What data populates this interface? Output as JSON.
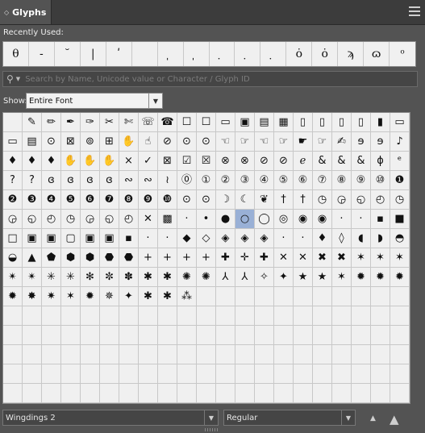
{
  "panel": {
    "tab_label": "Glyphs"
  },
  "recent": {
    "label": "Recently Used:",
    "glyphs": [
      "θ",
      "-",
      "˘",
      "|",
      "ʹ",
      "",
      "̩ ",
      "̩ ",
      "̣ ",
      "̣ ",
      "̣ ",
      "ȯ",
      "ȯ",
      "ϡ",
      "ɷ",
      "ᵒ"
    ]
  },
  "search": {
    "placeholder": "Search by Name, Unicode value or Character / Glyph ID",
    "value": ""
  },
  "show": {
    "label": "Show:",
    "value": "Entire Font"
  },
  "glyph_grid": {
    "selected_index": 117,
    "cells": [
      "",
      "✎",
      "✏",
      "✒",
      "✑",
      "✂",
      "✄",
      "☏",
      "☎",
      "☐",
      "☐",
      "▭",
      "▣",
      "▤",
      "▦",
      "▯",
      "▯",
      "▯",
      "▯",
      "▮",
      "▭",
      "▭",
      "▤",
      "⊙",
      "⊠",
      "⊚",
      "⊞",
      "✋",
      "☝",
      "⊘",
      "⊙",
      "⊙",
      "☜",
      "☞",
      "☜",
      "☞",
      "☛",
      "☞",
      "✍",
      "ɘ",
      "ɘ",
      "♪",
      "♦",
      "♦",
      "♦",
      "✋",
      "✋",
      "✋",
      "×",
      "✓",
      "⊠",
      "☑",
      "☒",
      "⊗",
      "⊗",
      "⊘",
      "⊘",
      "ℯ",
      "&",
      "&",
      "&",
      "ɸ",
      "ᵉ",
      "?",
      "?",
      "ɞ",
      "ɞ",
      "ɞ",
      "ɞ",
      "∾",
      "∾",
      "≀",
      "⓪",
      "①",
      "②",
      "③",
      "④",
      "⑤",
      "⑥",
      "⑦",
      "⑧",
      "⑨",
      "⑩",
      "❶",
      "❷",
      "❸",
      "❹",
      "❺",
      "❻",
      "❼",
      "❽",
      "❾",
      "❿",
      "⊙",
      "⊙",
      "☽",
      "☾",
      "❦",
      "†",
      "†",
      "◷",
      "◶",
      "◵",
      "◴",
      "◷",
      "◶",
      "◵",
      "◴",
      "◷",
      "◶",
      "◵",
      "◴",
      "✕",
      "▩",
      "·",
      "•",
      "●",
      "○",
      "◯",
      "◎",
      "◉",
      "◉",
      "·",
      "·",
      "▪",
      "■",
      "□",
      "▣",
      "▣",
      "▢",
      "▣",
      "▣",
      "▪",
      "·",
      "·",
      "◆",
      "◇",
      "◈",
      "◈",
      "◈",
      "·",
      "·",
      "♦",
      "◊",
      "◖",
      "◗",
      "◓",
      "◒",
      "▲",
      "⬟",
      "⬢",
      "⬢",
      "⬣",
      "⬣",
      "+",
      "+",
      "+",
      "+",
      "✚",
      "✛",
      "✚",
      "✕",
      "✕",
      "✖",
      "✖",
      "✶",
      "✶",
      "✶",
      "✴",
      "✴",
      "✳",
      "✳",
      "✻",
      "✼",
      "✽",
      "✱",
      "✱",
      "✺",
      "✺",
      "⅄",
      "⅄",
      "✧",
      "✦",
      "★",
      "★",
      "✶",
      "✹",
      "✹",
      "✹",
      "✹",
      "✸",
      "✷",
      "✶",
      "✹",
      "✵",
      "✦",
      "✱",
      "✱",
      "⁂",
      "",
      "",
      "",
      "",
      "",
      "",
      "",
      "",
      "",
      "",
      "",
      "",
      "",
      "",
      "",
      "",
      "",
      "",
      "",
      "",
      "",
      "",
      "",
      "",
      "",
      "",
      "",
      "",
      "",
      "",
      "",
      "",
      "",
      "",
      "",
      "",
      "",
      "",
      "",
      "",
      "",
      "",
      "",
      "",
      "",
      "",
      "",
      "",
      "",
      "",
      "",
      "",
      "",
      "",
      "",
      "",
      "",
      "",
      "",
      "",
      "",
      "",
      "",
      "",
      "",
      "",
      "",
      "",
      "",
      "",
      "",
      "",
      "",
      "",
      "",
      "",
      "",
      "",
      "",
      "",
      "",
      "",
      "",
      "",
      "",
      "",
      "",
      "",
      "",
      "",
      "",
      "",
      "",
      "",
      "",
      "",
      "",
      "",
      "",
      "",
      "",
      "",
      "",
      "",
      "",
      "",
      "",
      "",
      "",
      "",
      "",
      "",
      "",
      "",
      "",
      ""
    ]
  },
  "font": {
    "family": "Wingdings 2",
    "style": "Regular"
  }
}
